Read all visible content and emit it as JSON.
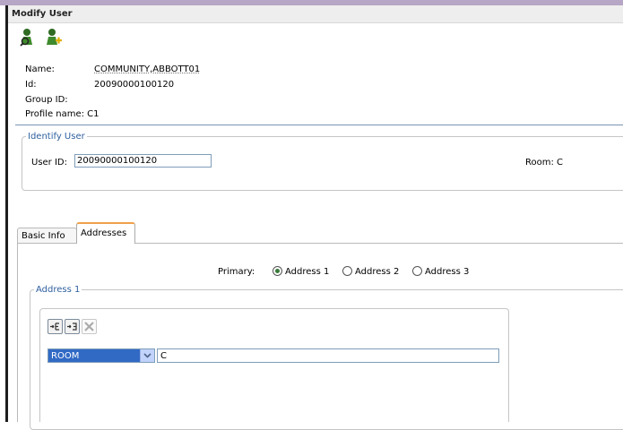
{
  "window": {
    "title": "Modify User"
  },
  "toolbar": {
    "icons": [
      "user-search-icon",
      "user-add-icon"
    ]
  },
  "user_info": {
    "name_label": "Name:",
    "name_value": "COMMUNITY,ABBOTT01",
    "id_label": "Id:",
    "id_value": "20090000100120",
    "group_label": "Group ID:",
    "profile_label": "Profile name: C1"
  },
  "identify": {
    "legend": "Identify User",
    "userid_label": "User ID:",
    "userid_value": "20090000100120",
    "room_label": "Room:  C"
  },
  "tabs": [
    {
      "label": "Basic Info",
      "active": false
    },
    {
      "label": "Addresses",
      "active": true
    }
  ],
  "addresses": {
    "primary_label": "Primary:",
    "options": [
      "Address 1",
      "Address 2",
      "Address 3"
    ],
    "selected": "Address 1",
    "section_legend": "Address 1",
    "field_type": "ROOM",
    "field_value": "C"
  },
  "colors": {
    "accent": "#2e5f9e",
    "select_bg": "#316ac5",
    "active_tab": "#f0a04b"
  }
}
